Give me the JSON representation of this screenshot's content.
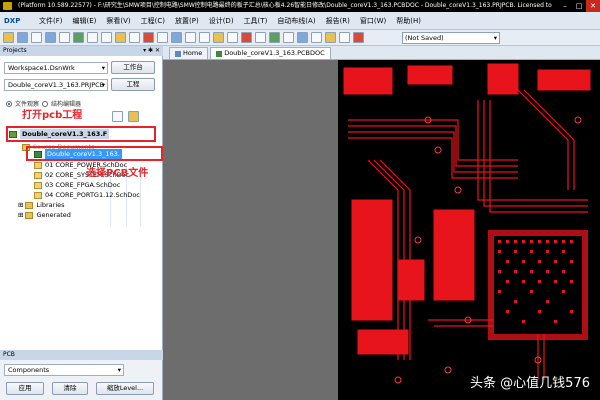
{
  "window": {
    "title": "(Platform 10.589.22577) - F:\\研究生\\SMW项目\\控制电路\\SMW控制电路最终的板子汇总\\核心板4.26智能日修改\\Double_coreV1.3_163.PCBDOC - Double_coreV1.3_163.PRJPCB. Licensed to",
    "controls": [
      "–",
      "□",
      "✕"
    ]
  },
  "menubar": {
    "brand": "DXP",
    "items": [
      "文件(F)",
      "编辑(E)",
      "察看(V)",
      "工程(C)",
      "放置(P)",
      "设计(D)",
      "工具(T)",
      "自动布线(A)",
      "报告(R)",
      "窗口(W)",
      "帮助(H)"
    ]
  },
  "toolbar": {
    "status_select": "(Not Saved)"
  },
  "projects_panel": {
    "title": "Projects",
    "workspace_value": "Workspace1.DsnWrk",
    "workspace_button": "工作台",
    "project_value": "Double_coreV1.3_163.PRJPCB",
    "project_button": "工程",
    "radio_file_view": "文件观察",
    "radio_structure": "结构编辑器",
    "tree": {
      "project": "Double_coreV1.3_163.F",
      "source_folder": "Source Documents",
      "pcb_doc": "Double_coreV1.3_163.",
      "docs": [
        "01 CORE_POWER.SchDoc",
        "02 CORE_SYSTEM.SchDoc",
        "03 CORE_FPGA.SchDoc",
        "04 CORE_PORTG1.12.SchDoc"
      ],
      "libraries": "Libraries",
      "generated": "Generated"
    }
  },
  "annotations": {
    "open_project": "打开pcb工程",
    "select_file": "选择PCB文件"
  },
  "bottom_panel": {
    "title": "PCB",
    "select_value": "Components",
    "apply": "应用",
    "clear": "清除",
    "zoom_level": "缩放Level..."
  },
  "doc_tabs": [
    "Home",
    "Double_coreV1.3_163.PCBDOC"
  ],
  "watermark": "头条 @心值几钱576",
  "colors": {
    "pcb_background": "#000000",
    "copper": "#e8141b",
    "annotation": "#e8232a",
    "selection": "#3399ff"
  }
}
